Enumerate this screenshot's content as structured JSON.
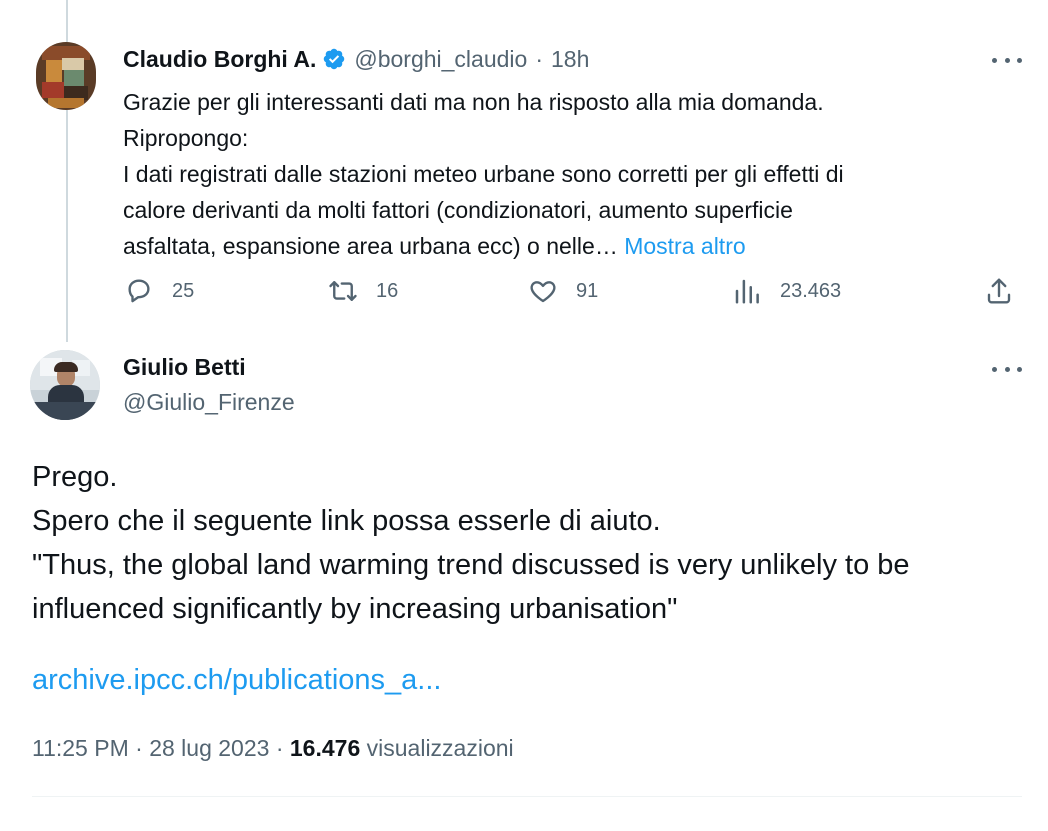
{
  "parent_tweet": {
    "author_name": "Claudio Borghi A.",
    "handle": "@borghi_claudio",
    "separator": "·",
    "time": "18h",
    "text_lines": [
      "Grazie per gli interessanti dati ma non ha risposto alla mia domanda.",
      "Ripropongo:",
      "I dati registrati dalle stazioni meteo urbane sono corretti per gli effetti di",
      "calore derivanti da molti fattori (condizionatori, aumento superficie"
    ],
    "last_line": "asfaltata, espansione area urbana ecc) o nelle…",
    "show_more": "Mostra altro",
    "replies": "25",
    "reposts": "16",
    "likes": "91",
    "views": "23.463"
  },
  "main_tweet": {
    "author_name": "Giulio Betti",
    "handle": "@Giulio_Firenze",
    "text_lines": [
      "Prego.",
      "Spero che il seguente link possa esserle di aiuto.",
      "\"Thus, the global land warming trend discussed is very unlikely to be",
      "influenced significantly by increasing urbanisation\""
    ],
    "link": "archive.ipcc.ch/publications_a...",
    "time": "11:25 PM",
    "dot": "·",
    "date": "28 lug 2023",
    "views_count": "16.476",
    "views_label": "visualizzazioni"
  },
  "colors": {
    "text": "#0f1419",
    "secondary": "#536471",
    "accent": "#1d9bf0",
    "verified": "#1d9bf0"
  },
  "icons": [
    "verified-badge-icon",
    "more-icon",
    "reply-icon",
    "repost-icon",
    "like-icon",
    "views-icon",
    "share-icon"
  ]
}
